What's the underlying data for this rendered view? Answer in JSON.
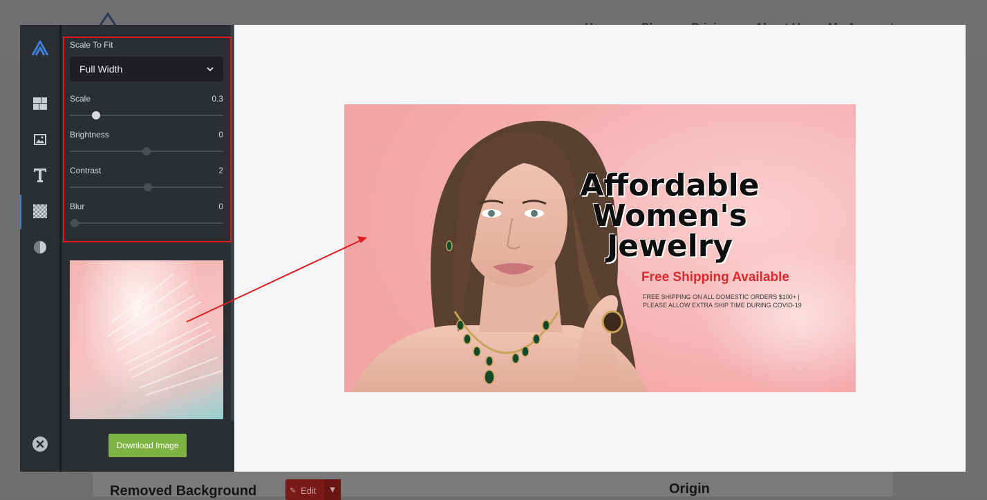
{
  "background_page": {
    "nav": [
      "Home",
      "Plans",
      "Pricing",
      "About Us",
      "My Account"
    ],
    "removed_background_title": "Removed Background",
    "edit_button": "Edit",
    "origin_title": "Origin"
  },
  "sidebar": {
    "icons": [
      {
        "name": "logo-icon"
      },
      {
        "name": "layout-icon"
      },
      {
        "name": "image-icon"
      },
      {
        "name": "text-icon"
      },
      {
        "name": "background-icon",
        "active": true
      },
      {
        "name": "filter-icon"
      },
      {
        "name": "close-icon"
      }
    ]
  },
  "panel": {
    "scale_to_fit": {
      "label": "Scale To Fit",
      "selected": "Full Width"
    },
    "scale": {
      "label": "Scale",
      "value": "0.3",
      "position": 0.17
    },
    "brightness": {
      "label": "Brightness",
      "value": "0",
      "position": 0.5
    },
    "contrast": {
      "label": "Contrast",
      "value": "2",
      "position": 0.51
    },
    "blur": {
      "label": "Blur",
      "value": "0",
      "position": 0.03
    },
    "download_label": "Download Image"
  },
  "canvas": {
    "headline_1": "Affordable",
    "headline_2": "Women's",
    "headline_3": "Jewelry",
    "subheadline": "Free Shipping Available",
    "note_1": "FREE SHIPPING ON ALL DOMESTIC ORDERS $100+  |",
    "note_2": "PLEASE ALLOW EXTRA SHIP TIME DURING COVID-19"
  },
  "colors": {
    "accent_blue": "#3d7fe0",
    "highlight_red": "#e01b1b",
    "download_green": "#7cb342",
    "promo_red": "#e0282c"
  }
}
